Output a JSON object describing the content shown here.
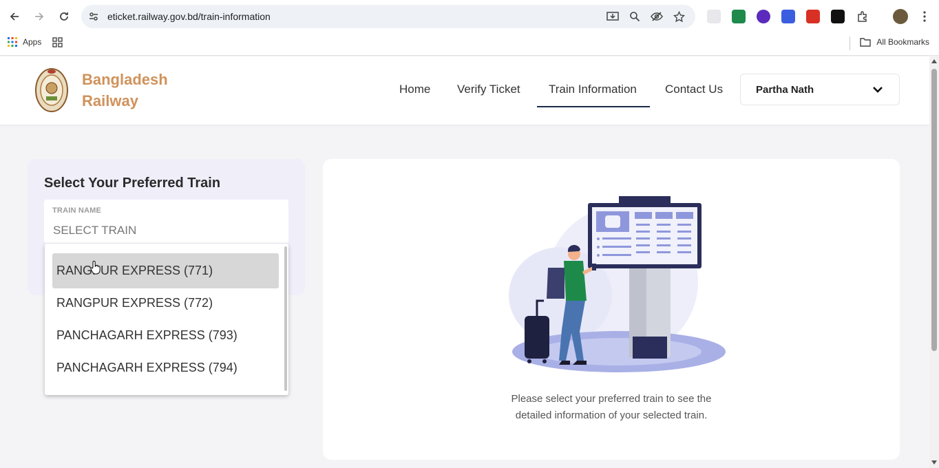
{
  "browser": {
    "url": "eticket.railway.gov.bd/train-information",
    "bookmarks": {
      "apps_label": "Apps",
      "all_bookmarks_label": "All Bookmarks"
    }
  },
  "header": {
    "brand_line1": "Bangladesh",
    "brand_line2": "Railway",
    "nav": {
      "home": "Home",
      "verify": "Verify Ticket",
      "train_info": "Train Information",
      "contact": "Contact Us"
    },
    "active_nav": "Train Information",
    "user_name": "Partha Nath"
  },
  "left_panel": {
    "title": "Select Your Preferred Train",
    "field_label": "TRAIN NAME",
    "field_placeholder": "SELECT TRAIN"
  },
  "dropdown": {
    "options": [
      "RANGPUR EXPRESS (771)",
      "RANGPUR EXPRESS (772)",
      "PANCHAGARH EXPRESS (793)",
      "PANCHAGARH EXPRESS (794)"
    ],
    "highlighted_index": 0
  },
  "card": {
    "message_line1": "Please select your preferred train to see the",
    "message_line2": "detailed information of your selected train."
  },
  "colors": {
    "brand": "#d0925b",
    "nav_active": "#1a2a48",
    "panel_bg": "#f0eef9",
    "illustration_accent": "#8f97dc"
  },
  "icons": [
    "back-icon",
    "forward-icon",
    "reload-icon",
    "site-settings-icon",
    "install-icon",
    "zoom-icon",
    "eye-off-icon",
    "star-icon",
    "extensions-icon",
    "profile-avatar",
    "menu-icon",
    "apps-grid-icon",
    "folder-icon",
    "chevron-down-icon"
  ]
}
